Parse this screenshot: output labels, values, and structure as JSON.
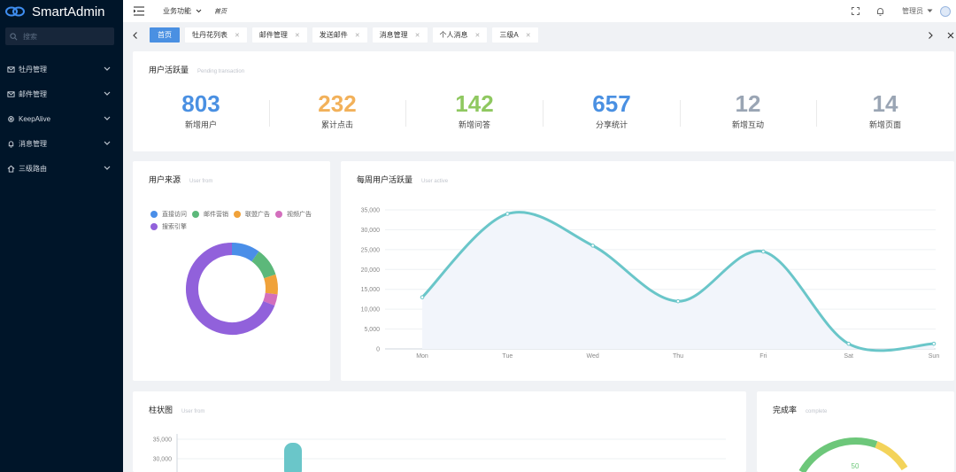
{
  "app": {
    "name": "SmartAdmin"
  },
  "sidebar": {
    "search_placeholder": "搜索",
    "items": [
      {
        "label": "牡丹管理",
        "icon": "mail-icon"
      },
      {
        "label": "邮件管理",
        "icon": "mail-icon"
      },
      {
        "label": "KeepAlive",
        "icon": "gear-icon"
      },
      {
        "label": "消息管理",
        "icon": "bell-icon"
      },
      {
        "label": "三级路由",
        "icon": "home-icon"
      }
    ]
  },
  "header": {
    "menu_label": "业务功能",
    "breadcrumb": "首页",
    "user": "管理员"
  },
  "tabs": [
    {
      "label": "首页",
      "active": true,
      "closable": false
    },
    {
      "label": "牡丹花列表",
      "closable": true
    },
    {
      "label": "邮件管理",
      "closable": true
    },
    {
      "label": "发送邮件",
      "closable": true
    },
    {
      "label": "消息管理",
      "closable": true
    },
    {
      "label": "个人消息",
      "closable": true
    },
    {
      "label": "三级A",
      "closable": true
    }
  ],
  "stats_card": {
    "title": "用户活跃量",
    "subtitle": "Pending transaction",
    "items": [
      {
        "value": "803",
        "label": "新增用户",
        "color": "#4a90e2"
      },
      {
        "value": "232",
        "label": "累计点击",
        "color": "#f2b15a"
      },
      {
        "value": "142",
        "label": "新增问答",
        "color": "#8fc860"
      },
      {
        "value": "657",
        "label": "分享统计",
        "color": "#4a90e2"
      },
      {
        "value": "12",
        "label": "新增互动",
        "color": "#9aa5b4"
      },
      {
        "value": "14",
        "label": "新增页面",
        "color": "#9aa5b4"
      }
    ]
  },
  "source_card": {
    "title": "用户来源",
    "subtitle": "User from"
  },
  "weekly_card": {
    "title": "每周用户活跃量",
    "subtitle": "User active"
  },
  "bar_card": {
    "title": "柱状图",
    "subtitle": "User from"
  },
  "done_card": {
    "title": "完成率",
    "subtitle": "complete",
    "gauge_label": "50"
  },
  "chart_data": [
    {
      "type": "pie",
      "variant": "donut",
      "categories": [
        "直接访问",
        "邮件营销",
        "联盟广告",
        "视频广告",
        "搜索引擎"
      ],
      "values": [
        10,
        10,
        7,
        4,
        69
      ],
      "colors": [
        "#4a8ee8",
        "#5cb87a",
        "#f0a23a",
        "#d36fbd",
        "#9161db"
      ],
      "legend": "top-left"
    },
    {
      "type": "area",
      "smooth": true,
      "categories": [
        "Mon",
        "Tue",
        "Wed",
        "Thu",
        "Fri",
        "Sat",
        "Sun"
      ],
      "values": [
        13000,
        34000,
        26000,
        12000,
        24500,
        1300,
        1300
      ],
      "yticks": [
        "0",
        "5,000",
        "10,000",
        "15,000",
        "20,000",
        "25,000",
        "30,000",
        "35,000"
      ],
      "ylim": [
        0,
        35000
      ],
      "color": "#6ac6c9",
      "grid": true
    },
    {
      "type": "bar",
      "yticks": [
        "30,000",
        "35,000"
      ],
      "ylim": [
        0,
        35000
      ],
      "values": [
        35000
      ],
      "color": "#6ac6c9"
    }
  ]
}
